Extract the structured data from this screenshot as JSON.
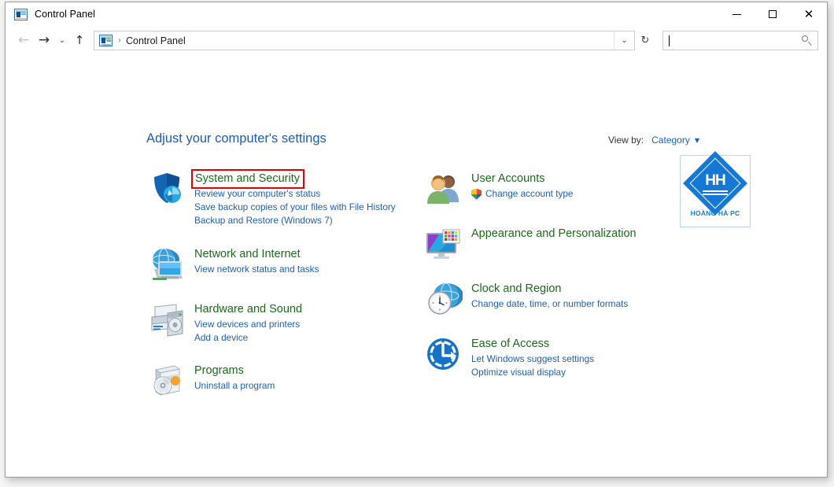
{
  "window": {
    "title": "Control Panel",
    "icon": "control-panel-icon",
    "minimize_label": "—",
    "maximize_label": "☐",
    "close_label": "✕"
  },
  "navbar": {
    "back_label": "←",
    "forward_label": "→",
    "recent_label": "⌄",
    "up_label": "↑",
    "breadcrumb": "Control Panel",
    "breadcrumb_separator": "›",
    "dropdown_label": "⌄",
    "refresh_label": "↻",
    "search_value": "",
    "search_placeholder": "",
    "search_icon": "search-icon"
  },
  "main": {
    "heading": "Adjust your computer's settings",
    "view_by_label": "View by:",
    "view_by_value": "Category",
    "view_by_caret": "▼"
  },
  "watermark": {
    "monogram": "HH",
    "caption": "HOÀNG HÀ PC",
    "color": "#1578d4"
  },
  "highlight": {
    "color": "#e60000",
    "target": "System and Security"
  },
  "colors": {
    "category_title": "#1a6b1a",
    "link": "#2060b4",
    "heading": "#1f5bb5"
  },
  "categories_left": [
    {
      "title": "System and Security",
      "icon": "shield-security-icon",
      "highlighted": true,
      "links": [
        "Review your computer's status",
        "Save backup copies of your files with File History",
        "Backup and Restore (Windows 7)"
      ]
    },
    {
      "title": "Network and Internet",
      "icon": "network-globe-icon",
      "highlighted": false,
      "links": [
        "View network status and tasks"
      ]
    },
    {
      "title": "Hardware and Sound",
      "icon": "printer-device-icon",
      "highlighted": false,
      "links": [
        "View devices and printers",
        "Add a device"
      ]
    },
    {
      "title": "Programs",
      "icon": "programs-box-icon",
      "highlighted": false,
      "links": [
        "Uninstall a program"
      ]
    }
  ],
  "categories_right": [
    {
      "title": "User Accounts",
      "icon": "user-accounts-icon",
      "highlighted": false,
      "links": [
        "Change account type"
      ],
      "shield_on_first_link": true
    },
    {
      "title": "Appearance and Personalization",
      "icon": "appearance-monitor-icon",
      "highlighted": false,
      "links": []
    },
    {
      "title": "Clock and Region",
      "icon": "clock-region-icon",
      "highlighted": false,
      "links": [
        "Change date, time, or number formats"
      ]
    },
    {
      "title": "Ease of Access",
      "icon": "ease-of-access-icon",
      "highlighted": false,
      "links": [
        "Let Windows suggest settings",
        "Optimize visual display"
      ]
    }
  ]
}
